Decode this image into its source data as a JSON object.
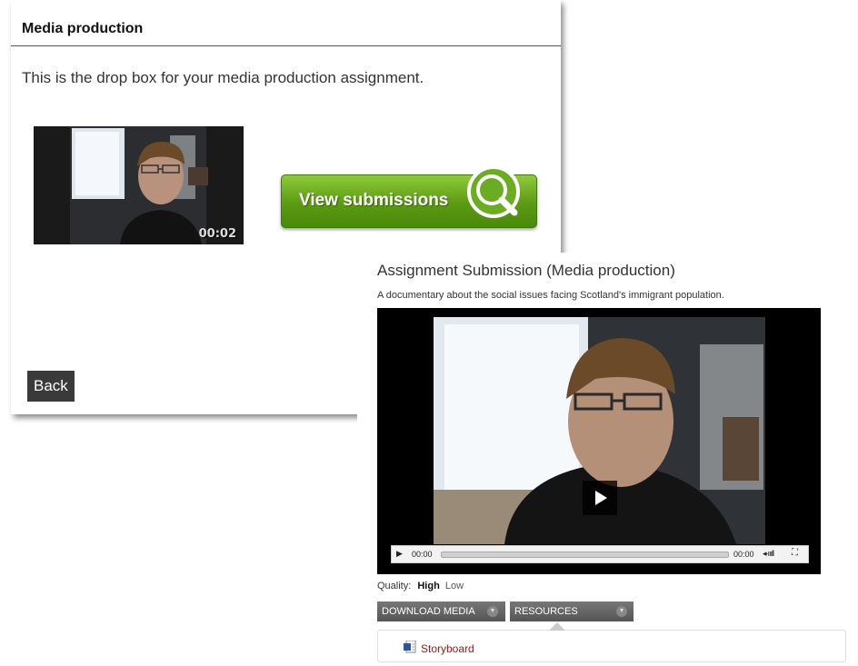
{
  "drop_box": {
    "title": "Media production",
    "description": "This is the drop box for your media production assignment.",
    "thumbnail_duration": "00:02",
    "view_button_label": "View submissions",
    "back_button_label": "Back"
  },
  "submission": {
    "title": "Assignment Submission (Media production)",
    "description": "A documentary about the social issues facing Scotland's immigrant population.",
    "player": {
      "current_time": "00:00",
      "total_time": "00:00",
      "progress": 0
    },
    "quality": {
      "label": "Quality:",
      "options": [
        "High",
        "Low"
      ],
      "selected": "High"
    },
    "buttons": {
      "download_label": "DOWNLOAD MEDIA",
      "resources_label": "RESOURCES"
    },
    "resources": [
      {
        "label": "Storyboard",
        "icon": "word-document-icon"
      }
    ]
  },
  "colors": {
    "view_button_green": "#5b9a13",
    "link_color": "#8b1a1a",
    "back_button_bg": "#3a3a3a"
  }
}
